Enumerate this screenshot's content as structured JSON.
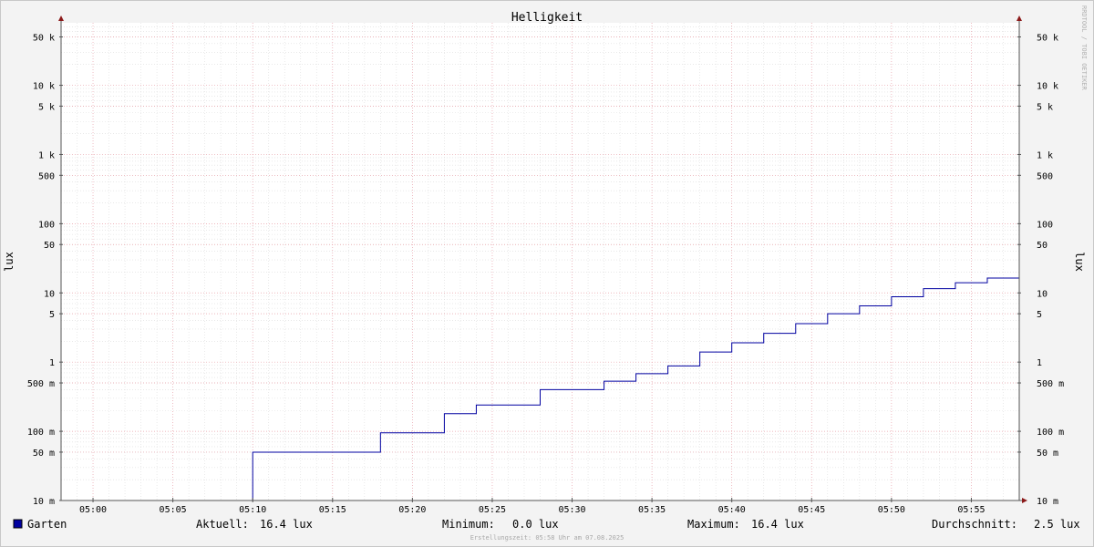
{
  "chart_data": {
    "type": "line",
    "title": "Helligkeit",
    "ylabel": "lux",
    "ylabel_right": "lux",
    "watermark": "RRDTOOL / TOBI OETIKER",
    "footer": "Erstellungszeit: 05:58 Uhr am 07.08.2025",
    "y_scale": "log",
    "ylim": [
      0.01,
      80000
    ],
    "x_range": [
      "04:58",
      "05:58"
    ],
    "grid": true,
    "legend_position": "bottom-left",
    "y_ticks": [
      {
        "value": 50000,
        "label": "50 k"
      },
      {
        "value": 10000,
        "label": "10 k"
      },
      {
        "value": 5000,
        "label": "5 k"
      },
      {
        "value": 1000,
        "label": "1 k"
      },
      {
        "value": 500,
        "label": "500"
      },
      {
        "value": 100,
        "label": "100"
      },
      {
        "value": 50,
        "label": "50"
      },
      {
        "value": 10,
        "label": "10"
      },
      {
        "value": 5,
        "label": "5"
      },
      {
        "value": 1,
        "label": "1"
      },
      {
        "value": 0.5,
        "label": "500 m"
      },
      {
        "value": 0.1,
        "label": "100 m"
      },
      {
        "value": 0.05,
        "label": "50 m"
      },
      {
        "value": 0.01,
        "label": "10 m"
      }
    ],
    "x_ticks": [
      "05:00",
      "05:05",
      "05:10",
      "05:15",
      "05:20",
      "05:25",
      "05:30",
      "05:35",
      "05:40",
      "05:45",
      "05:50",
      "05:55"
    ],
    "series": [
      {
        "name": "Garten",
        "color": "#0000a0",
        "points": [
          [
            "04:58",
            0.01
          ],
          [
            "05:10",
            0.05
          ],
          [
            "05:18",
            0.095
          ],
          [
            "05:22",
            0.18
          ],
          [
            "05:24",
            0.24
          ],
          [
            "05:28",
            0.4
          ],
          [
            "05:32",
            0.53
          ],
          [
            "05:34",
            0.68
          ],
          [
            "05:36",
            0.88
          ],
          [
            "05:38",
            1.4
          ],
          [
            "05:40",
            1.9
          ],
          [
            "05:42",
            2.6
          ],
          [
            "05:44",
            3.6
          ],
          [
            "05:46",
            5.0
          ],
          [
            "05:48",
            6.5
          ],
          [
            "05:50",
            8.8
          ],
          [
            "05:52",
            11.5
          ],
          [
            "05:54",
            14.0
          ],
          [
            "05:56",
            16.4
          ],
          [
            "05:58",
            16.4
          ]
        ]
      }
    ],
    "stats": {
      "current_label": "Aktuell:",
      "current_value": "16.4 lux",
      "min_label": "Minimum:",
      "min_value": "0.0 lux",
      "max_label": "Maximum:",
      "max_value": "16.4 lux",
      "avg_label": "Durchschnitt:",
      "avg_value": "2.5 lux"
    }
  }
}
